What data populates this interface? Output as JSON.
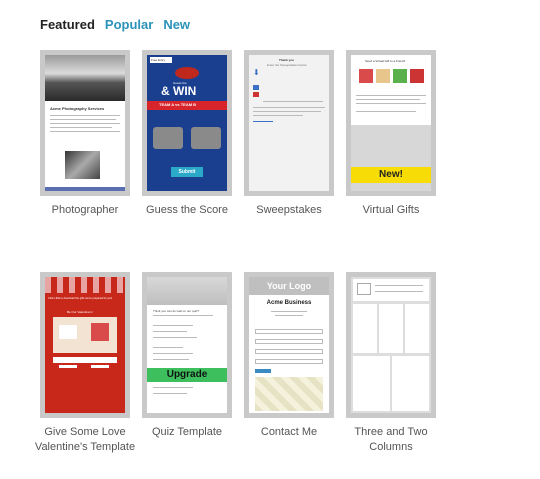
{
  "tabs": [
    {
      "label": "Featured",
      "active": true
    },
    {
      "label": "Popular",
      "active": false
    },
    {
      "label": "New",
      "active": false
    }
  ],
  "templates": [
    {
      "label": "Photographer",
      "thumb": {
        "heading": "Acme Photography Services"
      }
    },
    {
      "label": "Guess the Score",
      "thumb": {
        "banner_top": "Guess the",
        "win": "& WIN",
        "teams": "TEAM A vs TEAM B",
        "submit": "Submit",
        "tab_text": "Free Entry"
      }
    },
    {
      "label": "Sweepstakes",
      "thumb": {
        "title": "Thank you",
        "subtitle": "Enter the Sweepstakes below"
      }
    },
    {
      "label": "Virtual Gifts",
      "thumb": {
        "title": "Send a Virtual Gift to a Friend!",
        "badge": "New!"
      }
    },
    {
      "label": "Give Some Love Valentine's Template",
      "thumb": {
        "title": "Click LIKE to download the gifts we've prepared for you!",
        "subtitle": "Be Our Valentine's!"
      }
    },
    {
      "label": "Quiz Template",
      "thumb": {
        "question": "Think you can do well on our quiz?",
        "upgrade": "Upgrade"
      }
    },
    {
      "label": "Contact Me",
      "thumb": {
        "logo": "Your Logo",
        "business": "Acme Business"
      }
    },
    {
      "label": "Three and Two Columns",
      "thumb": {}
    }
  ],
  "colors": {
    "tab_link": "#2b93b8",
    "thumb_border": "#c9c9c9",
    "new_badge": "#f7dc06",
    "upgrade_bar": "#3dbf5e",
    "valentine_red": "#c8281a",
    "score_blue": "#1a3f8f"
  }
}
